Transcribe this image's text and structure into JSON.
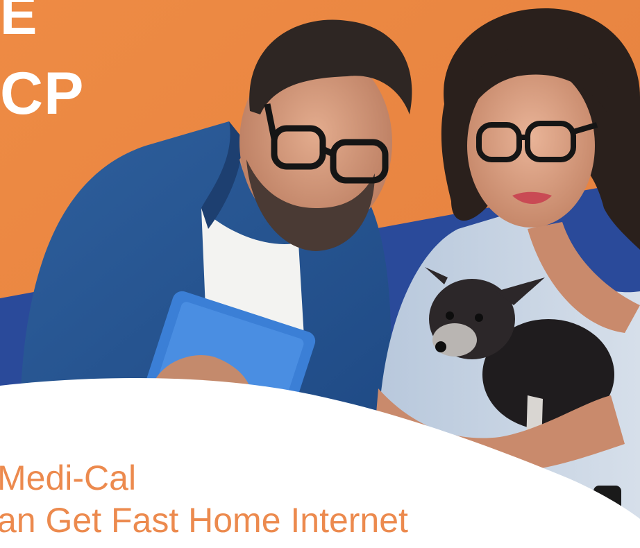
{
  "headline": {
    "line1": "E",
    "line2": "CP"
  },
  "subheadline": {
    "line1": "Medi-Cal",
    "line2": "an Get Fast Home Internet"
  },
  "colors": {
    "orange": "#e98a45",
    "navy": "#2a4a9a",
    "white": "#ffffff",
    "text_orange": "#ec8a4e"
  }
}
